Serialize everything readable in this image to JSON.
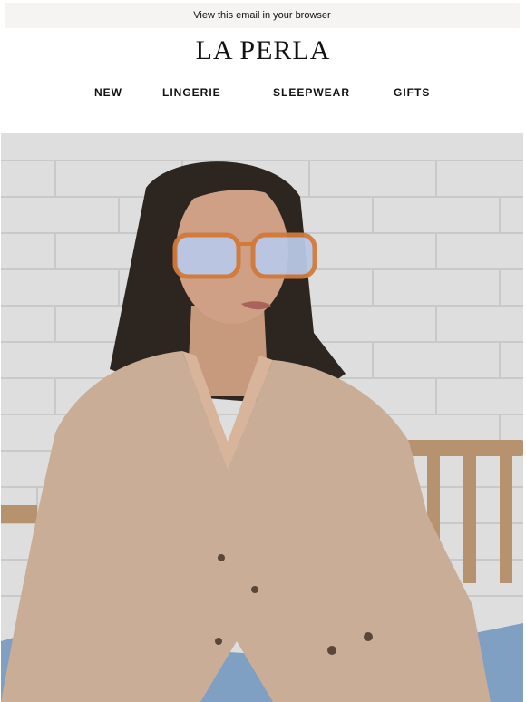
{
  "preheader": {
    "text": "View this email in your browser"
  },
  "brand": {
    "logo_text": "LA PERLA"
  },
  "nav": {
    "items": [
      {
        "label": "NEW"
      },
      {
        "label": "LINGERIE"
      },
      {
        "label": "SLEEPWEAR"
      },
      {
        "label": "GIFTS"
      }
    ]
  },
  "hero": {
    "image": "woman-in-beige-cardigan-and-tinted-glasses-photo"
  },
  "colors": {
    "preheader_bg": "#f5f4f2",
    "text": "#111111",
    "cardigan": "#c9ad96",
    "wall": "#dedede"
  }
}
